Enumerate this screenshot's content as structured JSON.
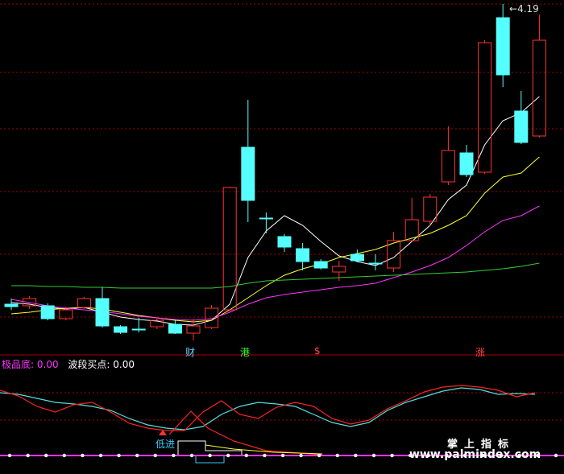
{
  "price_label": "4.19",
  "indicator": {
    "name": "极品底:",
    "name_value": "0.00",
    "second": "波段买点:",
    "second_value": "0.00"
  },
  "tags": {
    "cai": "财",
    "gang": "港",
    "s": "$",
    "zhang": "涨",
    "dijin": "低进"
  },
  "watermark": {
    "top": "掌上指标",
    "url": "www.palmindex.com"
  },
  "colors": {
    "up": "#ff3333",
    "down": "#55ffff",
    "ma_white": "#ffffff",
    "ma_yellow": "#ffff33",
    "ma_magenta": "#ff33ff",
    "ma_green": "#33cc33",
    "grid": "#aa0000"
  },
  "chart_data": {
    "type": "candlestick",
    "candles": [
      {
        "o": 378,
        "c": 381,
        "h": 371,
        "l": 385
      },
      {
        "o": 380,
        "c": 371,
        "h": 368,
        "l": 384
      },
      {
        "o": 380,
        "c": 396,
        "h": 377,
        "l": 398
      },
      {
        "o": 396,
        "c": 385,
        "h": 381,
        "l": 398
      },
      {
        "o": 382,
        "c": 371,
        "h": 369,
        "l": 384
      },
      {
        "o": 371,
        "c": 405,
        "h": 357,
        "l": 407
      },
      {
        "o": 406,
        "c": 413,
        "h": 404,
        "l": 415
      },
      {
        "o": 409,
        "c": 410,
        "h": 395,
        "l": 413
      },
      {
        "o": 406,
        "c": 398,
        "h": 395,
        "l": 409
      },
      {
        "o": 403,
        "c": 414,
        "h": 397,
        "l": 415
      },
      {
        "o": 414,
        "c": 405,
        "h": 396,
        "l": 423
      },
      {
        "o": 407,
        "c": 383,
        "h": 379,
        "l": 409
      },
      {
        "o": 385,
        "c": 233,
        "h": 232,
        "l": 387
      },
      {
        "o": 183,
        "c": 249,
        "h": 124,
        "l": 276
      },
      {
        "o": 271,
        "c": 272,
        "h": 264,
        "l": 290
      },
      {
        "o": 294,
        "c": 307,
        "h": 291,
        "l": 313
      },
      {
        "o": 309,
        "c": 325,
        "h": 302,
        "l": 336
      },
      {
        "o": 325,
        "c": 333,
        "h": 322,
        "l": 335
      },
      {
        "o": 338,
        "c": 331,
        "h": 324,
        "l": 349
      },
      {
        "o": 316,
        "c": 324,
        "h": 310,
        "l": 326
      },
      {
        "o": 327,
        "c": 328,
        "h": 316,
        "l": 336
      },
      {
        "o": 333,
        "c": 299,
        "h": 288,
        "l": 338
      },
      {
        "o": 299,
        "c": 273,
        "h": 246,
        "l": 300
      },
      {
        "o": 275,
        "c": 245,
        "h": 241,
        "l": 281
      },
      {
        "o": 226,
        "c": 187,
        "h": 157,
        "l": 230
      },
      {
        "o": 190,
        "c": 217,
        "h": 180,
        "l": 220
      },
      {
        "o": 214,
        "c": 53,
        "h": 50,
        "l": 216
      },
      {
        "o": 22,
        "c": 93,
        "h": 5,
        "l": 108
      },
      {
        "o": 138,
        "c": 177,
        "h": 113,
        "l": 179
      },
      {
        "o": 169,
        "c": 50,
        "h": 18,
        "l": 171
      }
    ],
    "ma": {
      "white": [
        376,
        378,
        382,
        384,
        382,
        388,
        394,
        397,
        399,
        403,
        404,
        398,
        378,
        320,
        287,
        268,
        280,
        300,
        318,
        325,
        330,
        320,
        300,
        280,
        248,
        230,
        180,
        150,
        140,
        120
      ],
      "yellow": [
        390,
        388,
        385,
        383,
        382,
        384,
        388,
        392,
        395,
        398,
        400,
        398,
        385,
        370,
        355,
        342,
        334,
        328,
        320,
        315,
        310,
        302,
        296,
        290,
        280,
        268,
        240,
        220,
        215,
        195
      ],
      "magenta": [
        372,
        376,
        380,
        383,
        385,
        387,
        390,
        393,
        395,
        397,
        398,
        396,
        388,
        378,
        370,
        366,
        363,
        360,
        357,
        355,
        352,
        345,
        338,
        330,
        320,
        305,
        288,
        274,
        268,
        256
      ],
      "green": [
        355,
        355,
        356,
        356,
        357,
        357,
        358,
        358,
        358,
        358,
        358,
        358,
        356,
        352,
        349,
        348,
        347,
        346,
        345,
        344,
        343,
        342,
        341,
        340,
        339,
        338,
        336,
        334,
        331,
        327
      ]
    },
    "osc": {
      "cyan": [
        488,
        490,
        495,
        500,
        502,
        505,
        510,
        520,
        528,
        532,
        534,
        530,
        515,
        505,
        500,
        502,
        505,
        515,
        525,
        530,
        525,
        510,
        500,
        493,
        486,
        482,
        484,
        490,
        489,
        490
      ],
      "red": [
        485,
        492,
        505,
        512,
        503,
        500,
        512,
        526,
        532,
        535,
        535,
        512,
        498,
        515,
        520,
        506,
        500,
        505,
        520,
        527,
        522,
        508,
        498,
        487,
        481,
        479,
        481,
        485,
        493,
        488
      ]
    }
  }
}
